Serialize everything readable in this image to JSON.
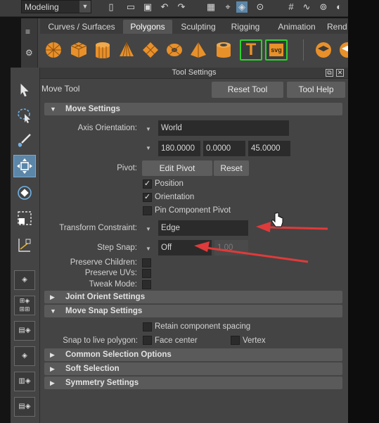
{
  "top_bar": {
    "mode": "Modeling"
  },
  "shelf": {
    "tabs": [
      "Curves / Surfaces",
      "Polygons",
      "Sculpting",
      "Rigging",
      "Animation",
      "Rend"
    ],
    "active_tab": "Polygons",
    "text_icon_label": "T",
    "svg_icon_label": "svg"
  },
  "toolbox": {
    "selected_tool": "move-tool"
  },
  "tool_settings": {
    "window_title": "Tool Settings",
    "tool_name": "Move Tool",
    "reset_tool": "Reset Tool",
    "tool_help": "Tool Help",
    "move_settings": {
      "header": "Move Settings",
      "axis_orientation_label": "Axis Orientation:",
      "axis_orientation_value": "World",
      "rotation_values": [
        "180.0000",
        "0.0000",
        "45.0000"
      ],
      "pivot_label": "Pivot:",
      "edit_pivot": "Edit Pivot",
      "reset": "Reset",
      "position": {
        "label": "Position",
        "checked": true
      },
      "orientation": {
        "label": "Orientation",
        "checked": true
      },
      "pin_component_pivot": {
        "label": "Pin Component Pivot",
        "checked": false
      },
      "transform_constraint_label": "Transform Constraint:",
      "transform_constraint_value": "Edge",
      "step_snap_label": "Step Snap:",
      "step_snap_value": "Off",
      "step_snap_amount": "1.00",
      "preserve_children_label": "Preserve Children:",
      "preserve_uvs_label": "Preserve UVs:",
      "tweak_mode_label": "Tweak Mode:"
    },
    "joint_orient_settings": "Joint Orient Settings",
    "move_snap_settings": {
      "header": "Move Snap Settings",
      "retain_component_spacing": "Retain component spacing",
      "snap_to_live_polygon_label": "Snap to live polygon:",
      "face_center": "Face center",
      "vertex": "Vertex"
    },
    "common_selection_options": "Common Selection Options",
    "soft_selection": "Soft Selection",
    "symmetry_settings": "Symmetry Settings"
  },
  "annotation_color": "#e03a3a"
}
